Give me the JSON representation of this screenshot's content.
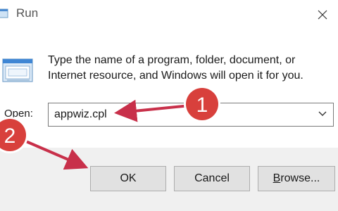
{
  "window": {
    "title": "Run",
    "close_icon": "close-icon",
    "app_icon": "run-app-icon"
  },
  "content": {
    "description": "Type the name of a program, folder, document, or Internet resource, and Windows will open it for you.",
    "open_label_prefix": "O",
    "open_label_rest": "pen:",
    "open_value": "appwiz.cpl"
  },
  "buttons": {
    "ok_label": "OK",
    "cancel_label": "Cancel",
    "browse_label_prefix": "B",
    "browse_label_rest": "rowse..."
  },
  "annotations": {
    "step1": "1",
    "step2": "2",
    "badge_color": "#d8403c",
    "arrow_color": "#c8304a"
  }
}
